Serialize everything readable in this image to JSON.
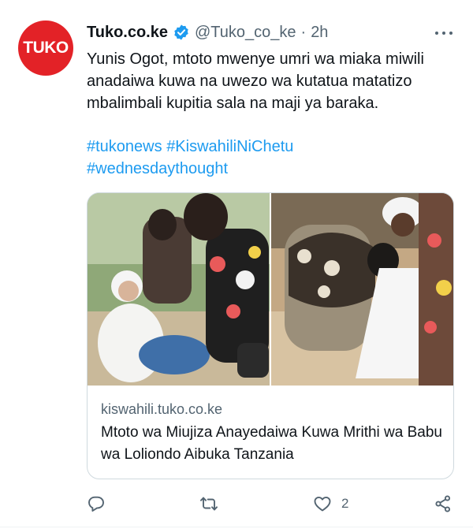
{
  "tweet": {
    "avatar_text": "TUKO",
    "display_name": "Tuko.co.ke",
    "handle": "@Tuko_co_ke",
    "separator": "·",
    "time": "2h",
    "text": "Yunis Ogot, mtoto mwenye umri wa miaka miwili anadaiwa kuwa na uwezo wa kutatua matatizo mbalimbali kupitia sala na maji ya baraka.",
    "hashtags": [
      "#tukonews",
      "#KiswahiliNiChetu",
      "#wednesdaythought"
    ],
    "card": {
      "domain": "kiswahili.tuko.co.ke",
      "title": "Mtoto wa Miujiza Anayedaiwa Kuwa Mrithi wa Babu wa Loliondo Aibuka Tanzania"
    },
    "actions": {
      "like_count": "2"
    }
  },
  "icons": {
    "verified": "verified-badge-icon",
    "more": "more-dots-icon",
    "reply": "reply-icon",
    "retweet": "retweet-icon",
    "like": "heart-icon",
    "share": "share-icon"
  },
  "colors": {
    "brand": "#e32227",
    "link": "#1d9bf0",
    "secondary_text": "#536471",
    "primary_text": "#0f1419",
    "border": "#cfd9de"
  }
}
